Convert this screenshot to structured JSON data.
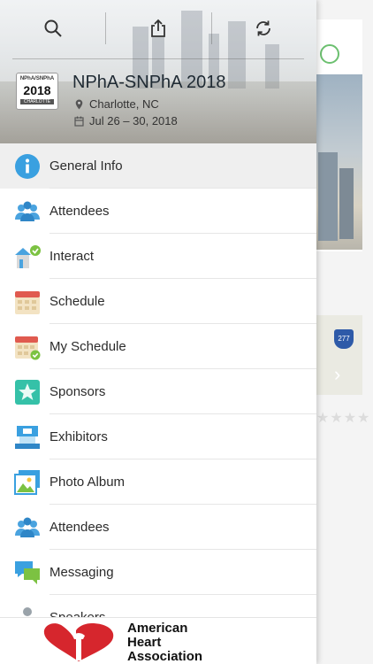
{
  "toolbar": {
    "icons": [
      "search-icon",
      "share-icon",
      "refresh-icon"
    ]
  },
  "event": {
    "title": "NPhA-SNPhA 2018",
    "location": "Charlotte, NC",
    "dates": "Jul 26 – 30, 2018",
    "logo": {
      "line1": "NPhA/SNPhA",
      "line2": "2018",
      "line3": "CHARLOTTE"
    }
  },
  "menu": [
    {
      "label": "General Info",
      "icon": "info-icon",
      "active": true
    },
    {
      "label": "Attendees",
      "icon": "people-icon"
    },
    {
      "label": "Interact",
      "icon": "interact-icon"
    },
    {
      "label": "Schedule",
      "icon": "calendar-icon"
    },
    {
      "label": "My Schedule",
      "icon": "calendar-check-icon"
    },
    {
      "label": "Sponsors",
      "icon": "star-icon"
    },
    {
      "label": "Exhibitors",
      "icon": "booth-icon"
    },
    {
      "label": "Photo Album",
      "icon": "photo-icon"
    },
    {
      "label": "Attendees",
      "icon": "people-icon"
    },
    {
      "label": "Messaging",
      "icon": "chat-icon"
    },
    {
      "label": "Speakers",
      "icon": "speaker-icon"
    }
  ],
  "footer": {
    "sponsor_line1": "American",
    "sponsor_line2": "Heart",
    "sponsor_line3": "Association"
  },
  "background": {
    "stars": "★★★★",
    "shield": "277"
  },
  "colors": {
    "accent_blue": "#3aa0e0",
    "calendar_red": "#e05a4f",
    "check_green": "#7cc242",
    "star_teal": "#35c1a8"
  }
}
